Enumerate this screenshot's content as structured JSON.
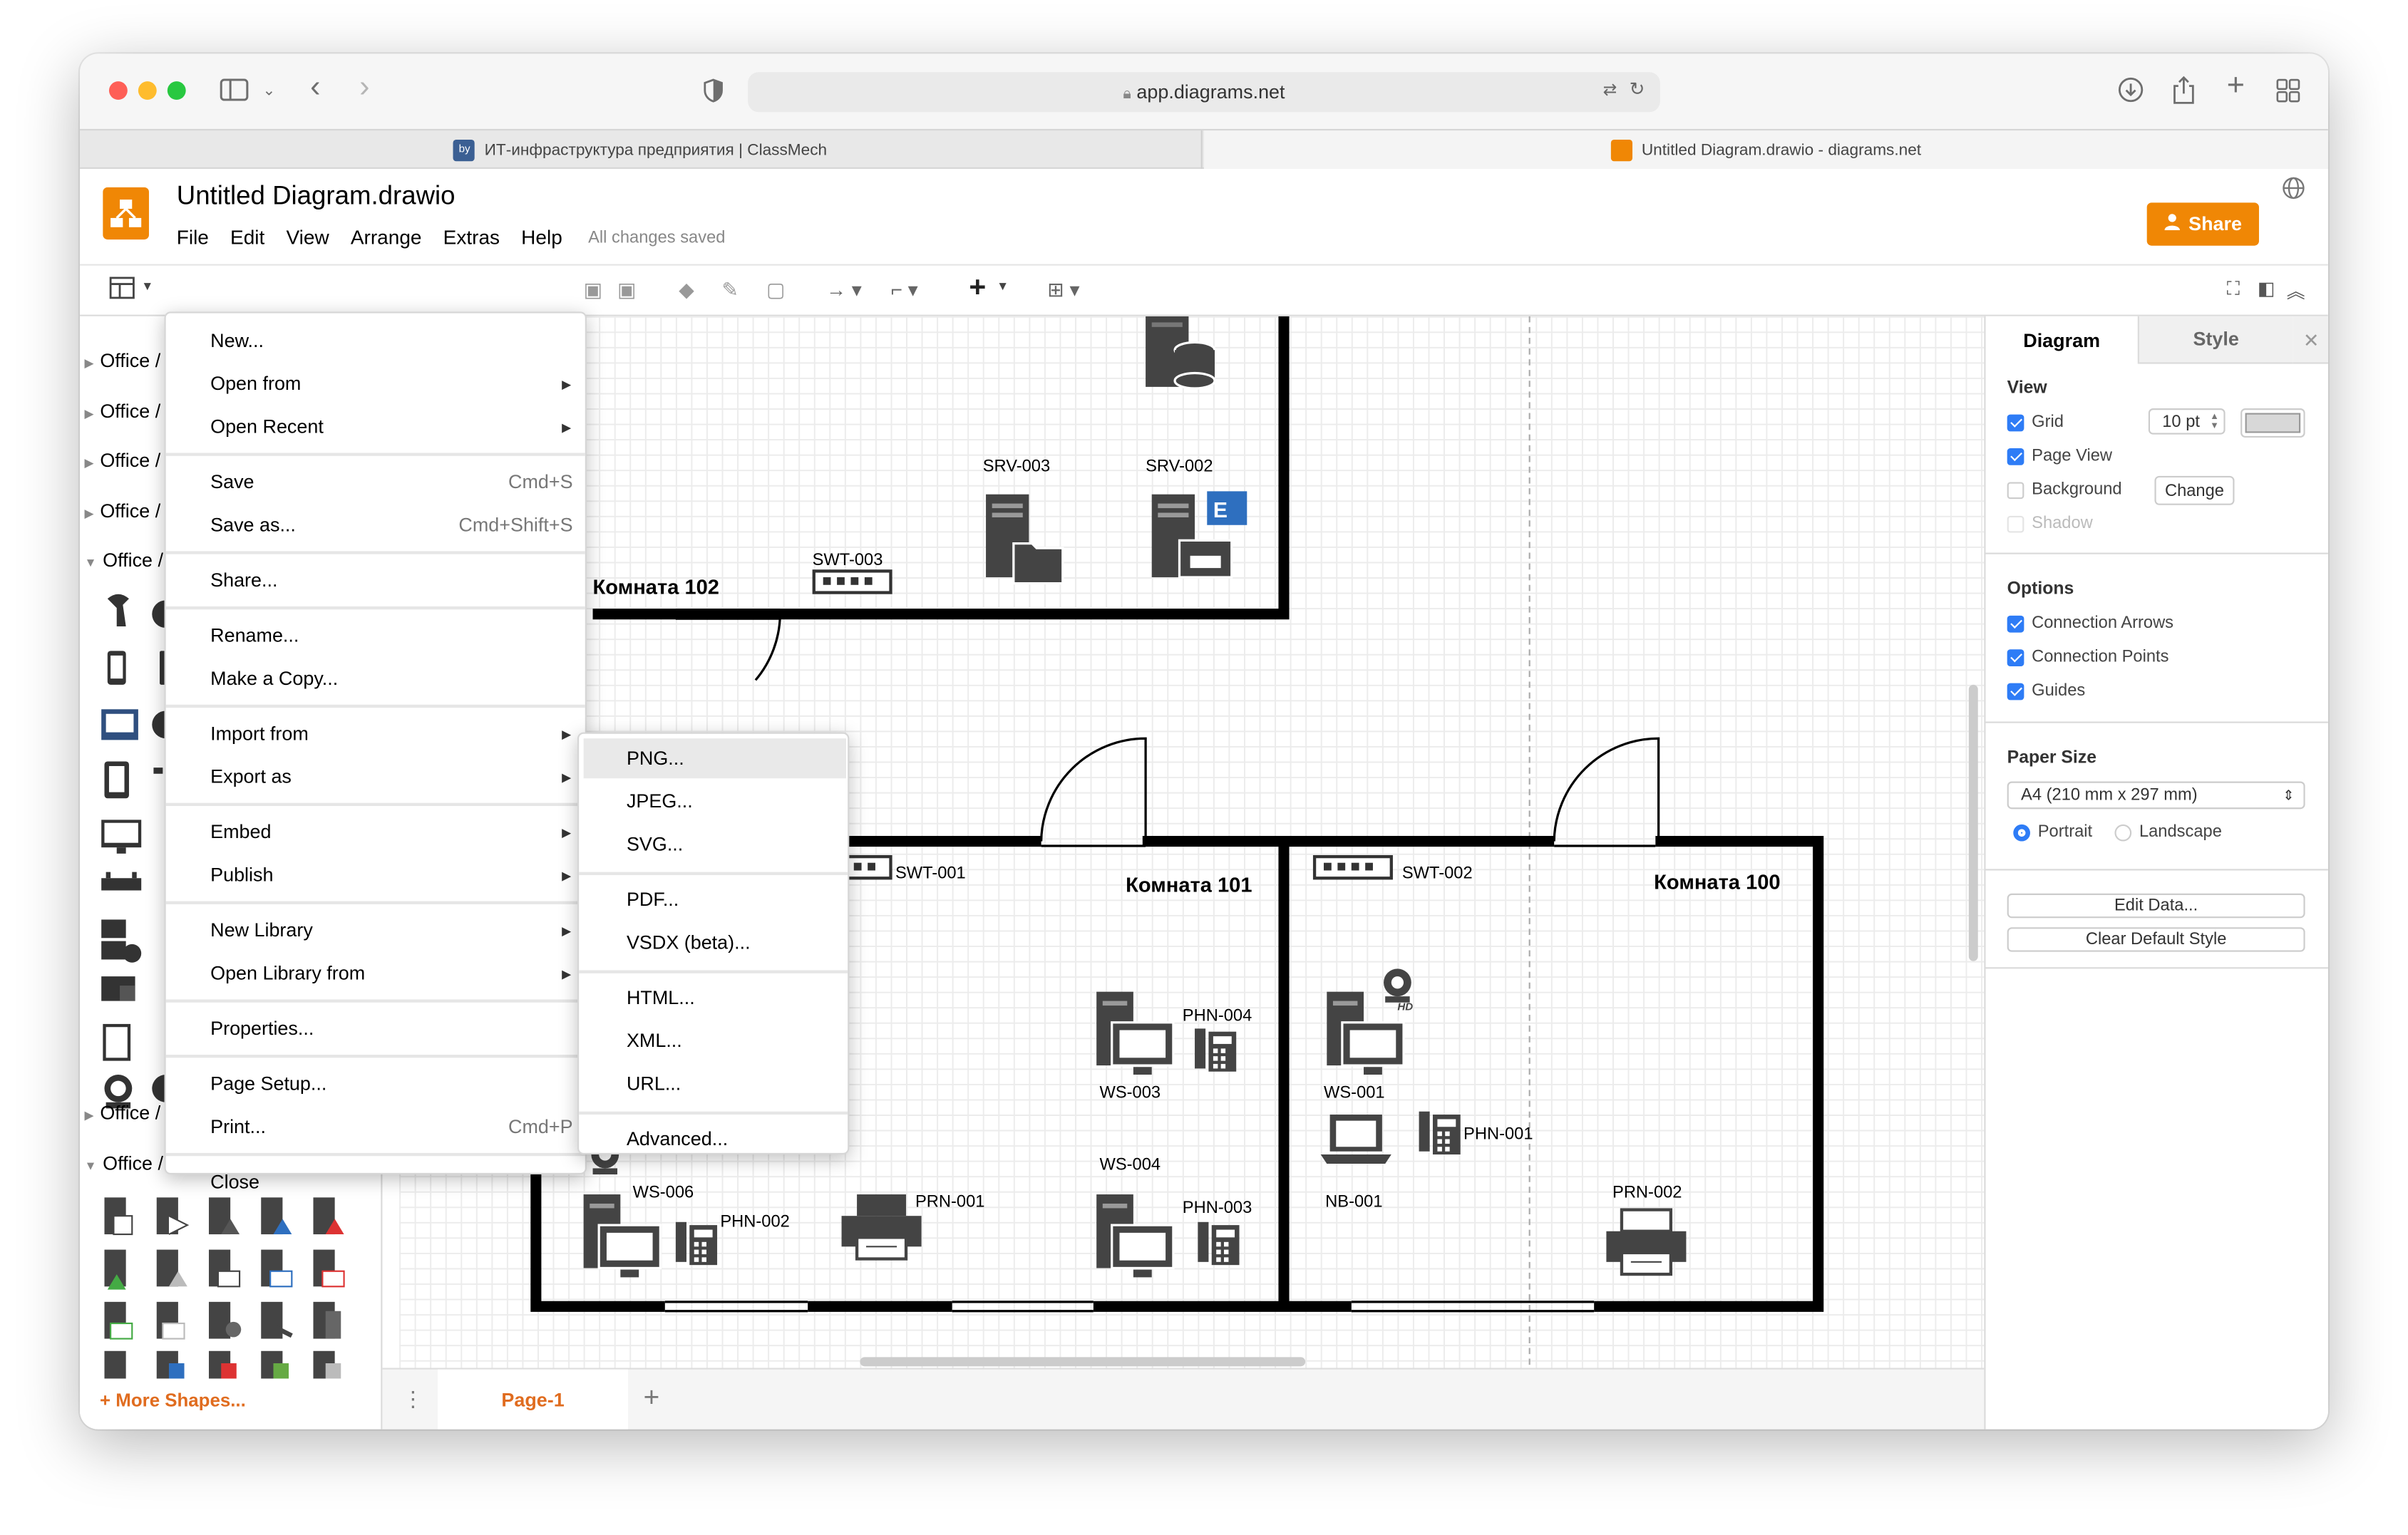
{
  "browser": {
    "url": "app.diagrams.net",
    "tabs": [
      {
        "title": "ИТ-инфраструктура предприятия | ClassMech",
        "active": false
      },
      {
        "title": "Untitled Diagram.drawio - diagrams.net",
        "active": true
      }
    ]
  },
  "app": {
    "title": "Untitled Diagram.drawio",
    "menus": [
      "File",
      "Edit",
      "View",
      "Arrange",
      "Extras",
      "Help"
    ],
    "status": "All changes saved",
    "share_label": "Share"
  },
  "sidebar": {
    "sections": [
      {
        "label": "Office /",
        "expanded": false
      },
      {
        "label": "Office /",
        "expanded": false
      },
      {
        "label": "Office /",
        "expanded": false
      },
      {
        "label": "Office /",
        "expanded": false
      },
      {
        "label": "Office /",
        "expanded": true
      },
      {
        "label": "Office /",
        "expanded": false
      },
      {
        "label": "Office / Servers",
        "expanded": true
      }
    ],
    "more_shapes": "+ More Shapes..."
  },
  "file_menu": {
    "groups": [
      [
        {
          "label": "New...",
          "shortcut": "",
          "submenu": false
        },
        {
          "label": "Open from",
          "shortcut": "",
          "submenu": true
        },
        {
          "label": "Open Recent",
          "shortcut": "",
          "submenu": true
        }
      ],
      [
        {
          "label": "Save",
          "shortcut": "Cmd+S",
          "submenu": false
        },
        {
          "label": "Save as...",
          "shortcut": "Cmd+Shift+S",
          "submenu": false
        }
      ],
      [
        {
          "label": "Share...",
          "shortcut": "",
          "submenu": false
        }
      ],
      [
        {
          "label": "Rename...",
          "shortcut": "",
          "submenu": false
        },
        {
          "label": "Make a Copy...",
          "shortcut": "",
          "submenu": false
        }
      ],
      [
        {
          "label": "Import from",
          "shortcut": "",
          "submenu": true
        },
        {
          "label": "Export as",
          "shortcut": "",
          "submenu": true
        }
      ],
      [
        {
          "label": "Embed",
          "shortcut": "",
          "submenu": true
        },
        {
          "label": "Publish",
          "shortcut": "",
          "submenu": true
        }
      ],
      [
        {
          "label": "New Library",
          "shortcut": "",
          "submenu": true
        },
        {
          "label": "Open Library from",
          "shortcut": "",
          "submenu": true
        }
      ],
      [
        {
          "label": "Properties...",
          "shortcut": "",
          "submenu": false
        }
      ],
      [
        {
          "label": "Page Setup...",
          "shortcut": "",
          "submenu": false
        },
        {
          "label": "Print...",
          "shortcut": "Cmd+P",
          "submenu": false
        }
      ],
      [
        {
          "label": "Close",
          "shortcut": "",
          "submenu": false
        }
      ]
    ]
  },
  "export_menu": {
    "highlighted": "PNG...",
    "groups": [
      [
        "PNG...",
        "JPEG...",
        "SVG..."
      ],
      [
        "PDF...",
        "VSDX (beta)..."
      ],
      [
        "HTML...",
        "XML...",
        "URL..."
      ],
      [
        "Advanced..."
      ]
    ]
  },
  "diagram": {
    "rooms": [
      "Комната 102",
      "Комната 101",
      "Комната 100"
    ],
    "devices": {
      "srv003": "SRV-003",
      "srv002": "SRV-002",
      "swt003": "SWT-003",
      "swt001": "SWT-001",
      "swt002": "SWT-002",
      "phn004": "PHN-004",
      "ws003": "WS-003",
      "ws001": "WS-001",
      "phn001": "PHN-001",
      "nb001": "NB-001",
      "ws004": "WS-004",
      "phn003": "PHN-003",
      "ws006": "WS-006",
      "phn002": "PHN-002",
      "prn001": "PRN-001",
      "prn002": "PRN-002"
    }
  },
  "pages": {
    "current": "Page-1"
  },
  "format_panel": {
    "tabs": [
      "Diagram",
      "Style"
    ],
    "view_label": "View",
    "grid_label": "Grid",
    "grid_size": "10 pt",
    "page_view_label": "Page View",
    "background_label": "Background",
    "change_label": "Change",
    "shadow_label": "Shadow",
    "options_label": "Options",
    "connection_arrows": "Connection Arrows",
    "connection_points": "Connection Points",
    "guides": "Guides",
    "paper_size_label": "Paper Size",
    "paper_size": "A4 (210 mm x 297 mm)",
    "portrait": "Portrait",
    "landscape": "Landscape",
    "edit_data": "Edit Data...",
    "clear_style": "Clear Default Style",
    "checks": {
      "grid": true,
      "page_view": true,
      "background": false,
      "shadow": false,
      "connection_arrows": true,
      "connection_points": true,
      "guides": true
    }
  }
}
